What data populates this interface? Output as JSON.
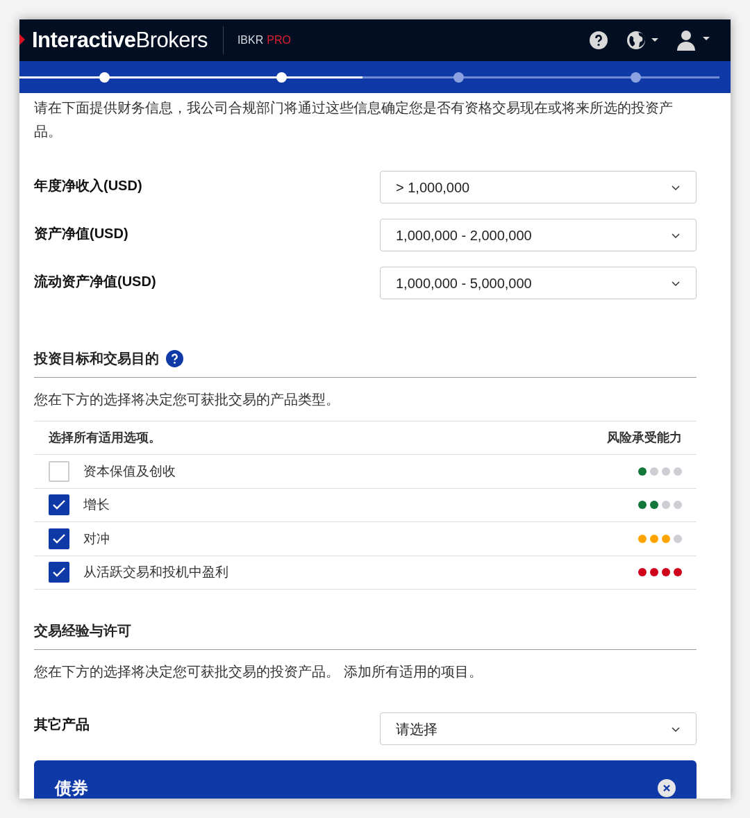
{
  "header": {
    "logo": "**Interactive**Brokers",
    "product": "IBKR",
    "product_tier": "PRO"
  },
  "progress": {
    "level": 0.49,
    "steps": [
      {
        "completed": true
      },
      {
        "completed": true
      },
      {
        "completed": false
      },
      {
        "completed": false
      }
    ]
  },
  "intro": "请在下面提供财务信息，我公司合规部门将通过这些信息确定您是否有资格交易现在或将来所选的投资产品。",
  "financial_fields": [
    {
      "label": "年度净收入(USD)",
      "value": "> 1,000,000"
    },
    {
      "label": "资产净值(USD)",
      "value": "1,000,000 - 2,000,000"
    },
    {
      "label": "流动资产净值(USD)",
      "value": "1,000,000 - 5,000,000"
    }
  ],
  "objectives": {
    "title": "投资目标和交易目的",
    "description": "您在下方的选择将决定您可获批交易的产品类型。",
    "columns": [
      "选择所有适用选项。",
      "风险承受能力"
    ],
    "rows": [
      {
        "label": "资本保值及创收",
        "checked": false,
        "stars": 1,
        "color": "#13773a"
      },
      {
        "label": "增长",
        "checked": true,
        "stars": 2,
        "color": "#13773a"
      },
      {
        "label": "对冲",
        "checked": true,
        "stars": 3,
        "color": "#ffa300"
      },
      {
        "label": "从活跃交易和投机中盈利",
        "checked": true,
        "stars": 4,
        "color": "#d0021b"
      }
    ]
  },
  "experience": {
    "title": "交易经验与许可",
    "description": "您在下方的选择将决定您可获批交易的投资产品。 添加所有适用的项目。",
    "field": {
      "label": "其它产品",
      "placeholder": "请选择"
    },
    "panel": {
      "title": "债券"
    }
  }
}
